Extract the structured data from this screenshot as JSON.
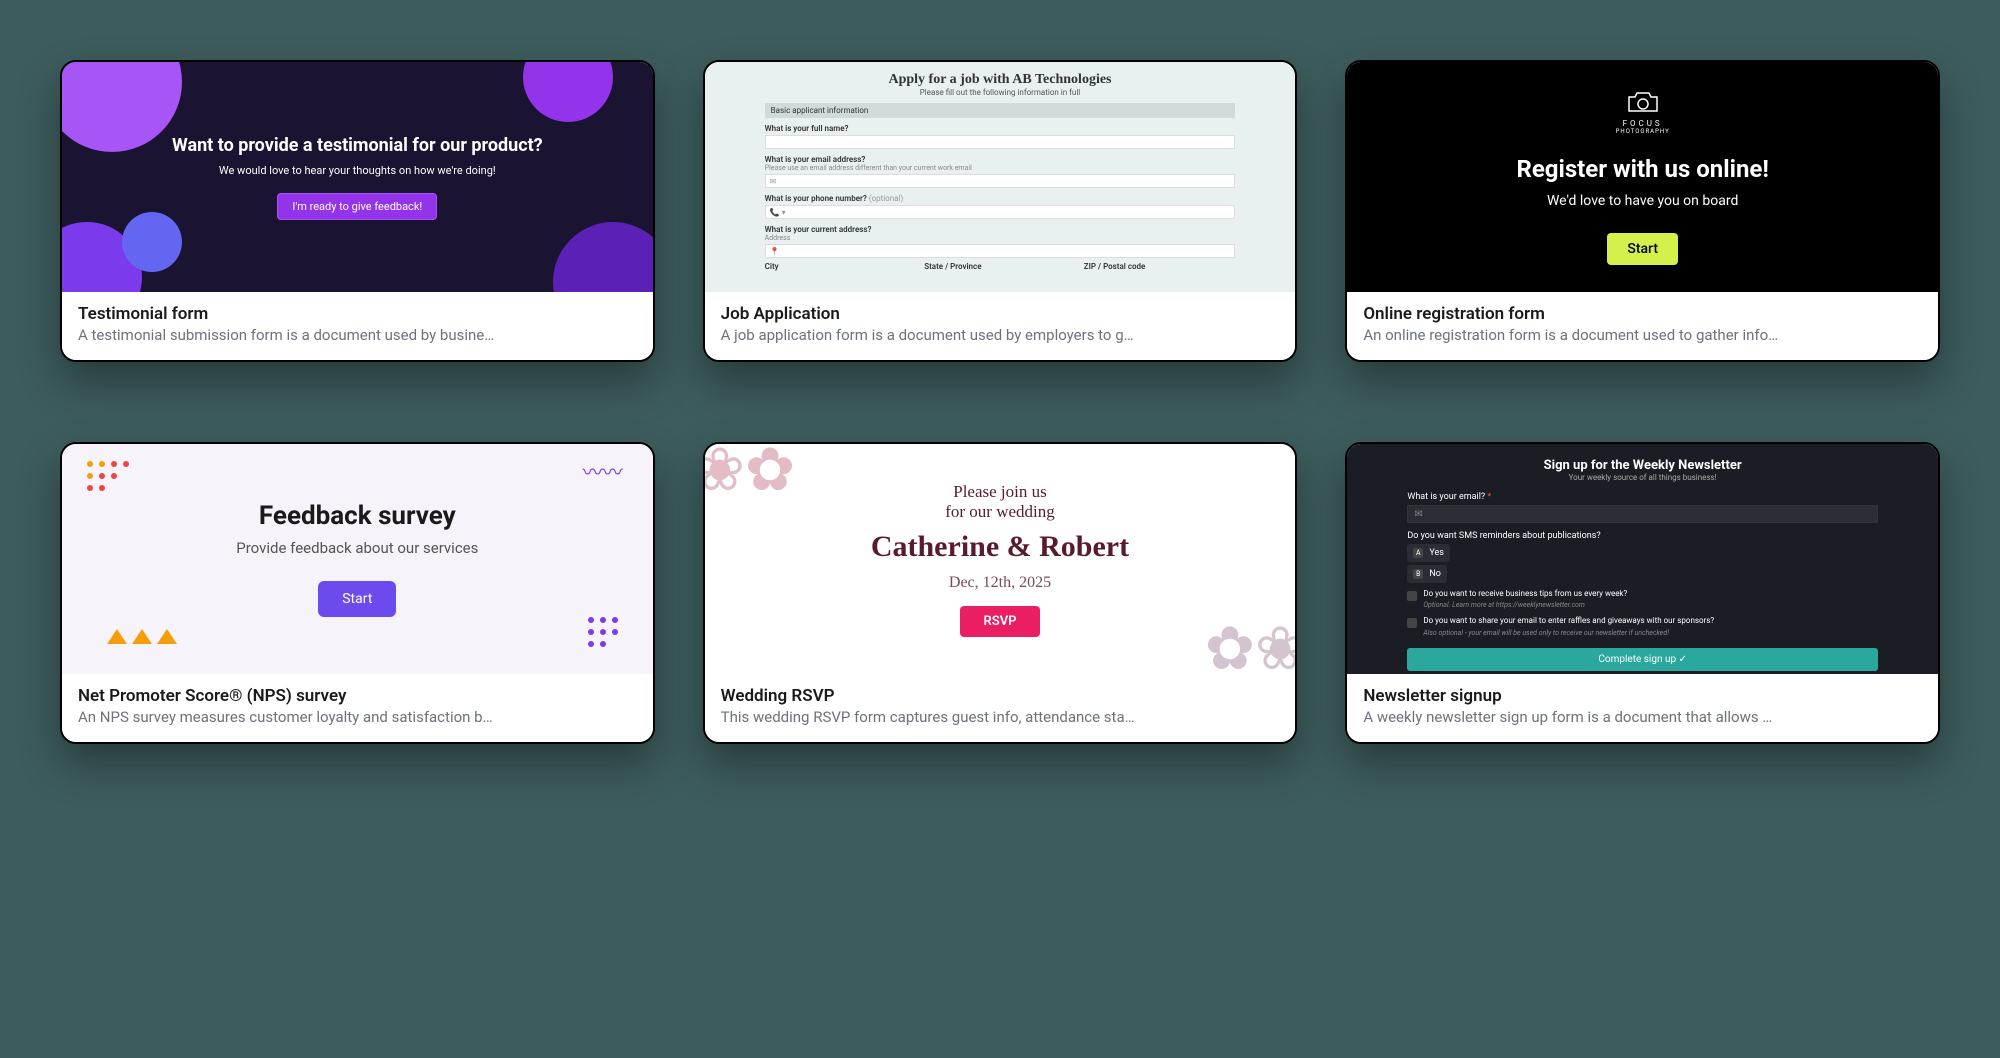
{
  "cards": [
    {
      "title": "Testimonial form",
      "desc": "A testimonial submission form is a document used by busine…",
      "preview": {
        "heading": "Want to provide a testimonial for our product?",
        "sub": "We would love to hear your thoughts on how we're doing!",
        "button": "I'm ready to give feedback!"
      }
    },
    {
      "title": "Job Application",
      "desc": "A job application form is a document used by employers to g…",
      "preview": {
        "heading": "Apply for a job with AB Technologies",
        "sub": "Please fill out the following information in full",
        "section": "Basic applicant information",
        "q_name": "What is your full name?",
        "q_email": "What is your email address?",
        "q_email_hint": "Please use an email address different than your current work email",
        "q_phone": "What is your phone number?",
        "optional": "(optional)",
        "q_address": "What is your current address?",
        "address_label": "Address",
        "city": "City",
        "state": "State / Province",
        "zip": "ZIP / Postal code"
      }
    },
    {
      "title": "Online registration form",
      "desc": "An online registration form is a document used to gather info…",
      "preview": {
        "logo": "FOCUS",
        "logo2": "PHOTOGRAPHY",
        "heading": "Register with us online!",
        "sub": "We'd love to have you on board",
        "button": "Start"
      }
    },
    {
      "title": "Net Promoter Score® (NPS) survey",
      "desc": "An NPS survey measures customer loyalty and satisfaction b…",
      "preview": {
        "heading": "Feedback survey",
        "sub": "Provide feedback about our services",
        "button": "Start"
      }
    },
    {
      "title": "Wedding RSVP",
      "desc": "This wedding RSVP form captures guest info, attendance sta…",
      "preview": {
        "line1": "Please join us",
        "line2": "for our wedding",
        "names": "Catherine & Robert",
        "date": "Dec, 12th, 2025",
        "button": "RSVP"
      }
    },
    {
      "title": "Newsletter signup",
      "desc": "A weekly newsletter sign up form is a document that allows …",
      "preview": {
        "heading": "Sign up for the Weekly Newsletter",
        "sub": "Your weekly source of all things business!",
        "q_email": "What is your email?",
        "q_sms": "Do you want SMS reminders about publications?",
        "opt_a": "A",
        "opt_yes": "Yes",
        "opt_b": "B",
        "opt_no": "No",
        "q_tips": "Do you want to receive business tips from us every week?",
        "tips_hint": "Optional. Learn more at https://weeklynewsletter.com",
        "q_share": "Do you want to share your email to enter raffles and giveaways with our sponsors?",
        "share_hint": "Also optional - your email will be used only to receive our newsletter if unchecked!",
        "button": "Complete sign up ✓"
      }
    }
  ]
}
